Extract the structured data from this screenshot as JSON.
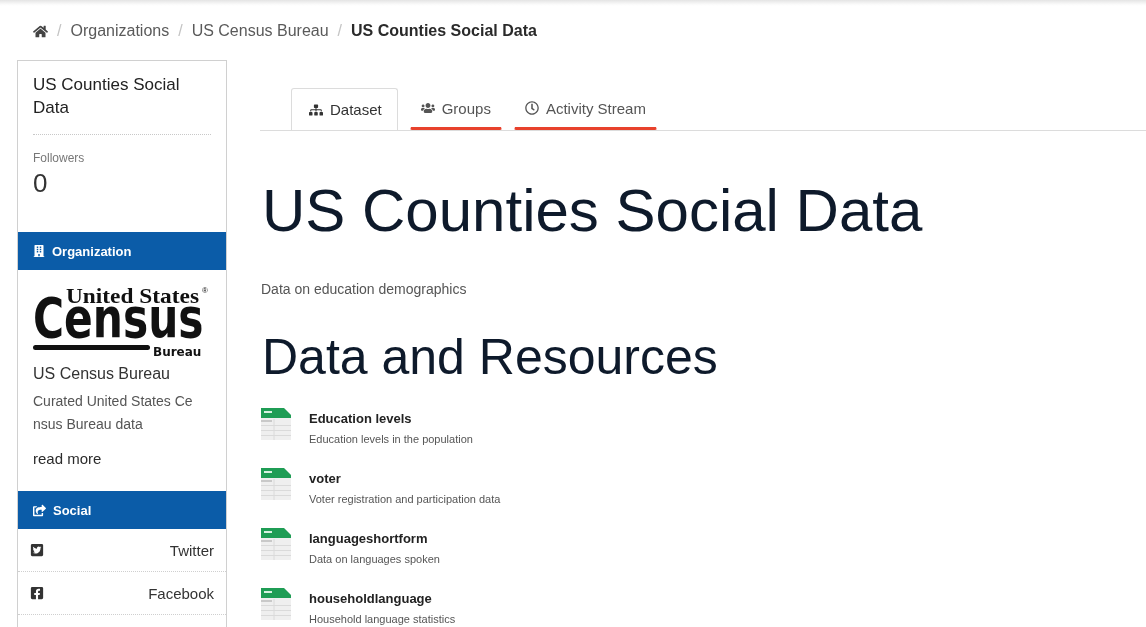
{
  "breadcrumb": {
    "separator": "/",
    "items": [
      {
        "label": "Organizations",
        "current": false
      },
      {
        "label": "US Census Bureau",
        "current": false
      },
      {
        "label": "US Counties Social Data",
        "current": true
      }
    ]
  },
  "sidebar": {
    "title": "US Counties Social Data",
    "followers": {
      "label": "Followers",
      "count": "0"
    },
    "organization": {
      "heading": "Organization",
      "logo": {
        "top": "United States",
        "mark": "®",
        "middle": "Census",
        "bottom": "Bureau"
      },
      "name": "US Census Bureau",
      "description": "Curated United States Census Bureau data",
      "read_more": "read more"
    },
    "social": {
      "heading": "Social",
      "links": [
        {
          "kind": "twitter",
          "label": "Twitter"
        },
        {
          "kind": "facebook",
          "label": "Facebook"
        }
      ]
    }
  },
  "tabs": [
    {
      "kind": "dataset",
      "label": "Dataset",
      "selected": true,
      "underlined": false
    },
    {
      "kind": "groups",
      "label": "Groups",
      "selected": false,
      "underlined": true
    },
    {
      "kind": "activity",
      "label": "Activity Stream",
      "selected": false,
      "underlined": true
    }
  ],
  "dataset": {
    "title": "US Counties Social Data",
    "description": "Data on education demographics",
    "resources_heading": "Data and Resources",
    "resources": [
      {
        "name": "Education levels",
        "description": "Education levels in the population"
      },
      {
        "name": "voter",
        "description": "Voter registration and participation data"
      },
      {
        "name": "languageshortform",
        "description": "Data on languages spoken"
      },
      {
        "name": "householdlanguage",
        "description": "Household language statistics"
      }
    ]
  }
}
